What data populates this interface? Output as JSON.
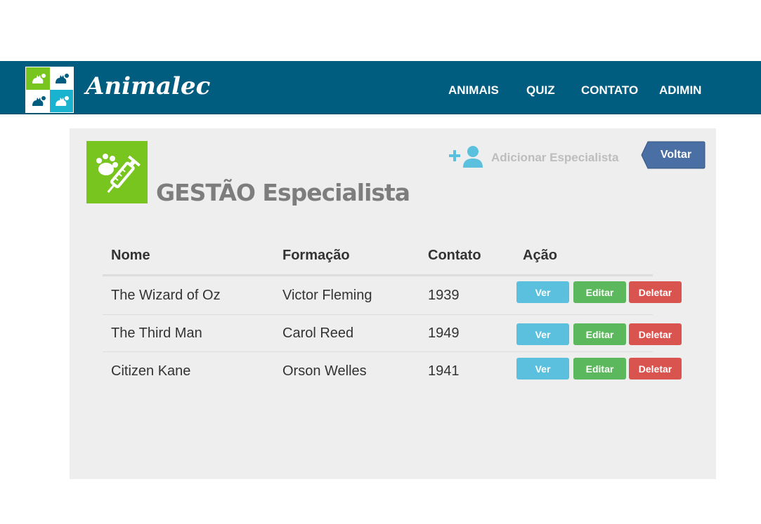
{
  "navbar": {
    "brand": "Animalec",
    "links": [
      "ANIMAIS",
      "QUIZ",
      "CONTATO",
      "ADIMIN"
    ],
    "logo_cells": [
      {
        "color": "#78c51f",
        "icon": "cat-icon"
      },
      {
        "color": "#ffffff",
        "icon": "cat-icon"
      },
      {
        "color": "#ffffff",
        "icon": "cat-icon"
      },
      {
        "color": "#1ab3cf",
        "icon": "cat-icon"
      }
    ]
  },
  "page": {
    "title": "GESTÃO Especialista",
    "feature_icon": "paw-syringe-icon",
    "add_label": "Adicionar Especialista",
    "back_label": "Voltar"
  },
  "table": {
    "headers": [
      "Nome",
      "Formação",
      "Contato",
      "Ação"
    ],
    "rows": [
      {
        "nome": "The Wizard of Oz",
        "formacao": "Victor Fleming",
        "contato": "1939"
      },
      {
        "nome": "The Third Man",
        "formacao": "Carol Reed",
        "contato": "1949"
      },
      {
        "nome": "Citizen Kane",
        "formacao": "Orson Welles",
        "contato": "1941"
      }
    ],
    "actions": {
      "ver": "Ver",
      "editar": "Editar",
      "deletar": "Deletar"
    }
  },
  "colors": {
    "navbar": "#005d80",
    "accent_green": "#78c51f",
    "info": "#5bc0de",
    "success": "#5cb85c",
    "danger": "#d9534f",
    "back_button": "#4a6fa5"
  }
}
